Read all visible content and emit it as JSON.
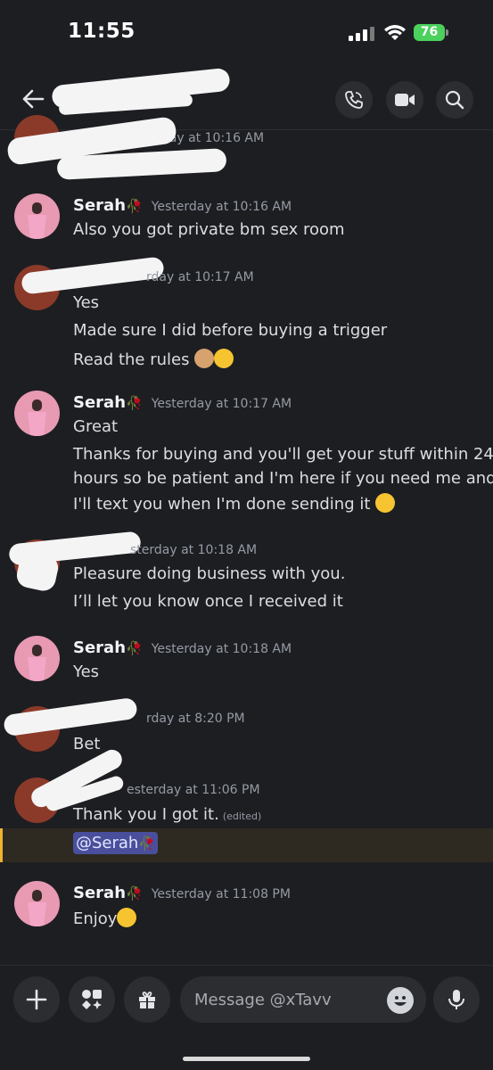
{
  "status_bar": {
    "time": "11:55",
    "battery": "76",
    "icons": [
      "signal-icon",
      "wifi-icon",
      "battery-icon"
    ]
  },
  "header": {
    "icons": [
      "back-arrow-icon",
      "phone-call-icon",
      "video-camera-icon",
      "search-icon"
    ]
  },
  "messages": [
    {
      "author": "",
      "timestamp": "sterday at 10:16 AM",
      "lines": [
        ""
      ]
    },
    {
      "author": "Serah",
      "timestamp": "Yesterday at 10:16 AM",
      "lines": [
        "Also you got private bm sex room"
      ]
    },
    {
      "author": "",
      "timestamp": "rday at 10:17 AM",
      "lines": [
        "Yes",
        "Made sure I did before buying a trigger",
        "Read the rules"
      ]
    },
    {
      "author": "Serah",
      "timestamp": "Yesterday at 10:17 AM",
      "lines": [
        "Great",
        "Thanks for buying and you'll get your stuff within 24",
        "hours so be patient and I'm here if you need me and",
        "I'll text you when I'm done sending it"
      ]
    },
    {
      "author": "",
      "timestamp": "sterday at 10:18 AM",
      "lines": [
        "Pleasure doing business with you.",
        "I’ll let you know once I received it"
      ]
    },
    {
      "author": "Serah",
      "timestamp": "Yesterday at 10:18 AM",
      "lines": [
        "Yes"
      ]
    },
    {
      "author": "",
      "timestamp": "rday at 8:20 PM",
      "lines": [
        "Bet"
      ]
    },
    {
      "author": "",
      "timestamp": "esterday at 11:06 PM",
      "lines": [
        "Thank you I got it."
      ],
      "edited": "(edited)",
      "mention": "@Serah"
    },
    {
      "author": "Serah",
      "timestamp": "Yesterday at 11:08 PM",
      "lines": [
        "Enjoy"
      ]
    }
  ],
  "composer": {
    "placeholder": "Message @xTavv",
    "icons": [
      "plus-icon",
      "apps-icon",
      "gift-icon",
      "emoji-icon",
      "microphone-icon"
    ]
  },
  "colors": {
    "background": "#1d1e22",
    "mention_highlight": "#f0b232",
    "mention_pill": "#4a4f9c",
    "avatar_pink": "#e79ab2",
    "battery_green": "#4bd15c"
  }
}
